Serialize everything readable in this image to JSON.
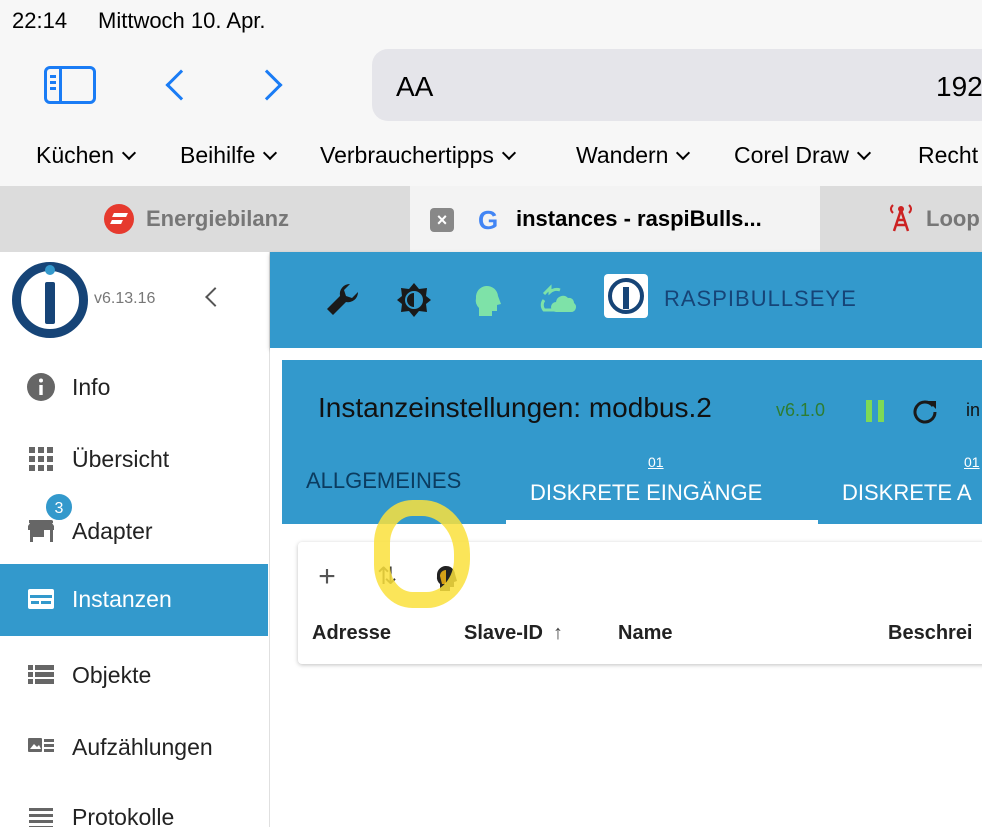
{
  "status_bar": {
    "time": "22:14",
    "date": "Mittwoch 10. Apr."
  },
  "browser": {
    "url_text_size": "AA",
    "url": "192",
    "bookmarks": [
      "Küchen",
      "Beihilfe",
      "Verbrauchertipps",
      "Wandern",
      "Corel Draw",
      "Recht"
    ],
    "tabs": [
      {
        "title": "Energiebilanz",
        "icon": "energy-favicon"
      },
      {
        "title": "instances - raspiBulls...",
        "icon": "google-favicon",
        "active": true
      },
      {
        "title": "Loop",
        "icon": "radio-tower-favicon"
      }
    ],
    "close_icon": "×",
    "google_glyph": "G"
  },
  "sidebar": {
    "version": "v6.13.16",
    "adapter_badge": "3",
    "items": [
      {
        "label": "Info",
        "icon": "info-icon"
      },
      {
        "label": "Übersicht",
        "icon": "grid-icon"
      },
      {
        "label": "Adapter",
        "icon": "store-icon"
      },
      {
        "label": "Instanzen",
        "icon": "instances-icon",
        "active": true
      },
      {
        "label": "Objekte",
        "icon": "list-icon"
      },
      {
        "label": "Aufzählungen",
        "icon": "enum-icon"
      },
      {
        "label": "Protokolle",
        "icon": "log-icon"
      }
    ]
  },
  "appbar": {
    "host": "RASPIBULLSEYE",
    "icons": [
      "wrench-icon",
      "brightness-icon",
      "expert-head-icon",
      "cloud-sync-icon"
    ]
  },
  "instance": {
    "title": "Instanzeinstellungen: modbus.2",
    "version": "v6.1.0",
    "more_text": "in",
    "tabs": [
      {
        "num": "",
        "label": "ALLGEMEINES"
      },
      {
        "num": "01",
        "label": "DISKRETE EINGÄNGE"
      },
      {
        "num": "01",
        "label": "DISKRETE A"
      }
    ]
  },
  "table": {
    "toolbar_icons": [
      "add-icon",
      "import-export-icon",
      "expert-mode-icon"
    ],
    "add_glyph": "+",
    "sort_glyph": "⇅",
    "columns": [
      "Adresse",
      "Slave-ID",
      "Name",
      "Beschrei"
    ],
    "sort_arrow": "↑"
  },
  "colors": {
    "accent": "#3399cc",
    "ios_blue": "#1a7cf5",
    "logo_navy": "#164477",
    "version_green": "#2e7d32",
    "highlight_yellow": "#fae13c"
  }
}
